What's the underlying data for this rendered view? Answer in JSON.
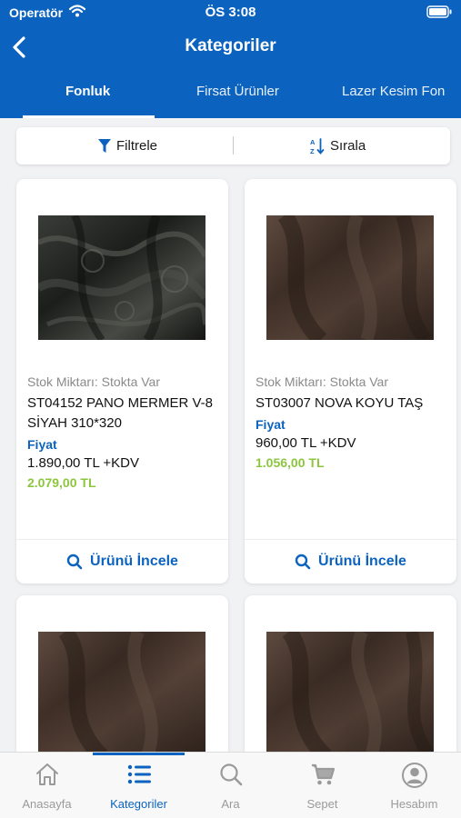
{
  "status": {
    "carrier": "Operatör",
    "time": "ÖS 3:08"
  },
  "nav": {
    "title": "Kategoriler"
  },
  "tabs": [
    {
      "label": "Fonluk",
      "active": true
    },
    {
      "label": "Firsat Ürünler",
      "active": false
    },
    {
      "label": "Lazer Kesim Fon",
      "active": false
    }
  ],
  "filters": {
    "filter_label": "Filtrele",
    "sort_label": "Sırala"
  },
  "products": [
    {
      "stock": "Stok Miktarı: Stokta Var",
      "name": "ST04152 PANO MERMER V-8 SİYAH 310*320",
      "price_label": "Fiyat",
      "price_kdv": "1.890,00 TL +KDV",
      "price_total": "2.079,00 TL",
      "action": "Ürünü İncele",
      "image": "black-marble-jacquard-fabric"
    },
    {
      "stock": "Stok Miktarı: Stokta Var",
      "name": "ST03007 NOVA KOYU TAŞ",
      "price_label": "Fiyat",
      "price_kdv": "960,00 TL +KDV",
      "price_total": "1.056,00 TL",
      "action": "Ürünü İncele",
      "image": "dark-stone-brown-fabric"
    },
    {
      "image": "dark-brown-fabric"
    },
    {
      "image": "dark-brown-fabric"
    }
  ],
  "tabbar": [
    {
      "label": "Anasayfa",
      "icon": "home-icon",
      "active": false
    },
    {
      "label": "Kategoriler",
      "icon": "list-icon",
      "active": true
    },
    {
      "label": "Ara",
      "icon": "search-icon",
      "active": false
    },
    {
      "label": "Sepet",
      "icon": "cart-icon",
      "active": false
    },
    {
      "label": "Hesabım",
      "icon": "account-icon",
      "active": false
    }
  ],
  "colors": {
    "primary": "#0c63bf",
    "price_green": "#8cc63e",
    "background": "#f1f2f4"
  }
}
